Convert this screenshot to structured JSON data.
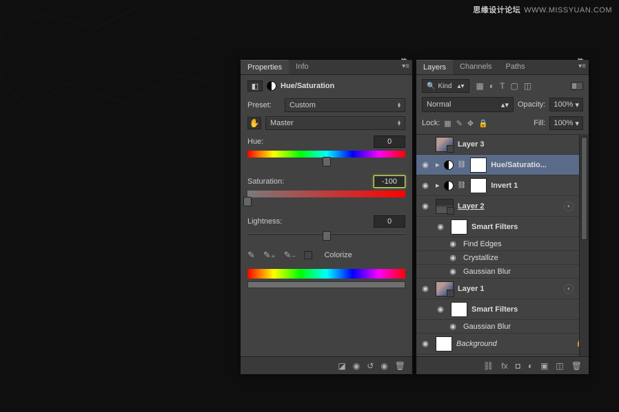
{
  "watermark": {
    "cn": "思缘设计论坛",
    "url": "WWW.MISSYUAN.COM"
  },
  "properties": {
    "tabs": [
      "Properties",
      "Info"
    ],
    "adj_title": "Hue/Saturation",
    "preset_label": "Preset:",
    "preset_value": "Custom",
    "channel_value": "Master",
    "hue_label": "Hue:",
    "hue_value": "0",
    "sat_label": "Saturation:",
    "sat_value": "-100",
    "light_label": "Lightness:",
    "light_value": "0",
    "colorize_label": "Colorize"
  },
  "layers": {
    "tabs": [
      "Layers",
      "Channels",
      "Paths"
    ],
    "kind_label": "Kind",
    "blend_mode": "Normal",
    "opacity_label": "Opacity:",
    "opacity_value": "100%",
    "lock_label": "Lock:",
    "fill_label": "Fill:",
    "fill_value": "100%",
    "items": [
      {
        "name": "Layer 3"
      },
      {
        "name": "Hue/Saturatio..."
      },
      {
        "name": "Invert 1"
      },
      {
        "name": "Layer 2"
      },
      {
        "name": "Smart Filters"
      },
      {
        "name": "Find Edges"
      },
      {
        "name": "Crystallize"
      },
      {
        "name": "Gaussian Blur"
      },
      {
        "name": "Layer 1"
      },
      {
        "name": "Smart Filters"
      },
      {
        "name": "Gaussian Blur"
      },
      {
        "name": "Background"
      }
    ]
  }
}
